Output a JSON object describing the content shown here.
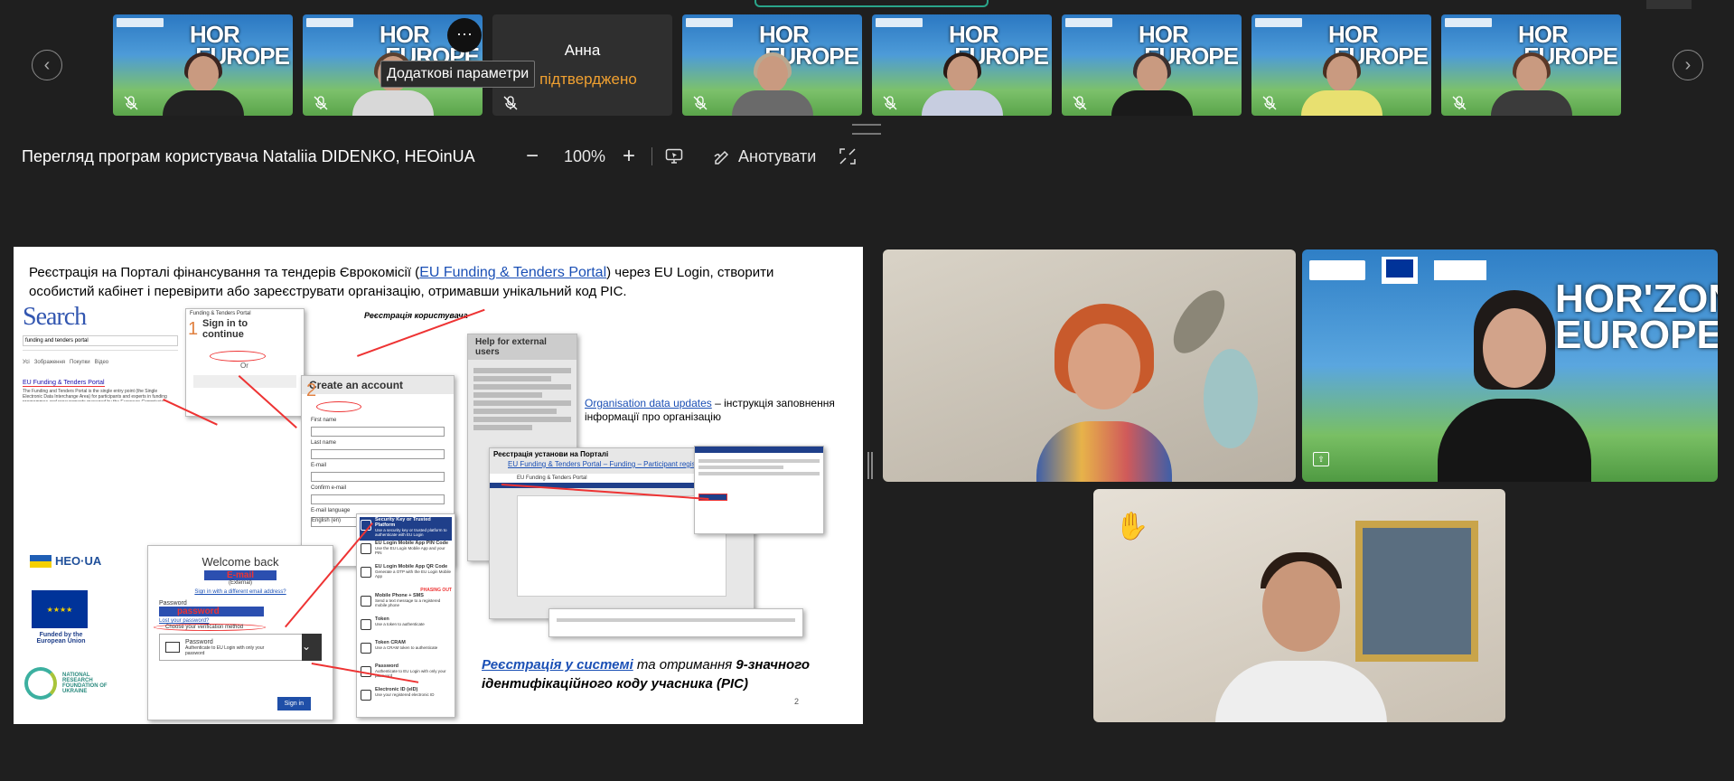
{
  "thumbnails": {
    "prev_label": "‹",
    "next_label": "›",
    "name_tile": {
      "name": "Анна",
      "status": "е підтверджено"
    },
    "tooltip": "Додаткові параметри",
    "more_button": "···",
    "horizon_text": "HOR'ZON EUROPE"
  },
  "share_toolbar": {
    "title": "Перегляд програм користувача Nataliia DIDENKO, HEOinUA",
    "zoom_out": "−",
    "zoom_level": "100%",
    "zoom_in": "+",
    "annotate_label": "Анотувати"
  },
  "slide": {
    "title_part1": "Реєстрація на Порталі фінансування та тендерів Єврокомісії (",
    "title_link": "EU Funding & Tenders Portal",
    "title_part2": ") через EU Login, створити особистий кабінет і перевірити або зареєструвати організацію, отримавши унікальний код PIC.",
    "search_logo": "Search",
    "search_query": "funding and tenders portal",
    "search_result_link": "EU Funding & Tenders Portal",
    "search_result_text": "The Funding and Tenders Portal is the single entry point (the Single Electronic Data Interchange Area) for participants and experts in funding programmes and procurements managed by the European Commission.",
    "sign_in_header": "Funding & Tenders Portal",
    "sign_in_title": "Sign in to continue",
    "step1": "1",
    "step2": "2",
    "or_label": "Or",
    "registration_label": "Реєстрація користувача",
    "help_title": "Help for external users",
    "create_account_title": "Create an account",
    "create_account_fields": [
      "First name",
      "Last name",
      "E-mail",
      "Confirm e-mail",
      "E-mail language"
    ],
    "email_language_value": "English (en)",
    "welcome_title": "Welcome back",
    "welcome_email": "E-mail",
    "welcome_external": "(External)",
    "welcome_sign_in_other": "Sign in with a different email address?",
    "password_label": "Password",
    "password_value": "password",
    "lost_password": "Lost your password?",
    "verification_label": "Choose your verification method",
    "method_title": "Password",
    "method_desc": "Authenticate to EU Login with only your password",
    "sign_in_button": "Sign in",
    "methods": [
      {
        "title": "Security Key or Trusted Platform",
        "desc": "Use a security key or trusted platform to authenticate with EU Login"
      },
      {
        "title": "EU Login Mobile App PIN Code",
        "desc": "Use the EU Login Mobile App and your PIN"
      },
      {
        "title": "EU Login Mobile App QR Code",
        "desc": "Generate a OTP with the EU Login Mobile App"
      },
      {
        "title": "Mobile Phone + SMS",
        "desc": "Send a text message to a registered mobile phone"
      },
      {
        "title": "Token",
        "desc": "Use a token to authenticate"
      },
      {
        "title": "Token CRAM",
        "desc": "Use a CRAM token to authenticate"
      },
      {
        "title": "Password",
        "desc": "Authenticate to EU Login with only your password"
      },
      {
        "title": "Electronic ID (eID)",
        "desc": "Use your registered electronic ID"
      }
    ],
    "phase_out": "PHASING OUT",
    "org_link": "Organisation data updates",
    "org_text": " – інструкція заповнення інформації про організацію",
    "reg_title": "Реєстрація установи на Порталі",
    "reg_link": "EU Funding & Tenders Portal – Funding – Participant register",
    "portal_bar": "EU Funding & Tenders Portal",
    "bottom_link": "Реєстрація у системі",
    "bottom_mid": " та отримання ",
    "bottom_bold": "9-значного ідентифікаційного коду учасника (PIC)",
    "page_number": "2",
    "logo_heo": "HEO·UA",
    "funded_by": "Funded by the European Union",
    "nrf": "NATIONAL RESEARCH FOUNDATION OF UKRAINE"
  },
  "colors": {
    "background": "#1f1f1f",
    "link": "#1a4fb5",
    "accent_red": "#e33333",
    "eu_blue": "#003399",
    "orange": "#f0a030"
  },
  "video_tiles": {
    "hand_icon": "raised-hand-icon",
    "pin_icon": "pin-icon"
  }
}
